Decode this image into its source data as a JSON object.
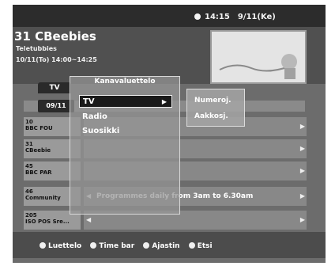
{
  "clock": {
    "time": "14:15",
    "date": "9/11(Ke)"
  },
  "info": {
    "channel_title": "31 CBeebies",
    "program_title": "Teletubbies",
    "program_time": "10/11(To) 14:00~14:25"
  },
  "guide": {
    "tab_label": "TV",
    "date_chip": "09/11",
    "rows": [
      {
        "channel": "10\nBBC FOU",
        "program": ""
      },
      {
        "channel": "31\nCBeebie",
        "program": ""
      },
      {
        "channel": "45\nBBC PAR",
        "program": ""
      },
      {
        "channel": "46\nCommunity",
        "program": "Programmes daily from 3am to 6.30am"
      },
      {
        "channel": "205\nISO POS Sre...",
        "program": ""
      }
    ]
  },
  "menu": {
    "title": "Kanavaluettelo",
    "items": [
      "TV",
      "Radio",
      "Suosikki"
    ],
    "submenu": [
      "Numeroj.",
      "Aakkosj."
    ]
  },
  "legend": [
    "Luettelo",
    "Time bar",
    "Ajastin",
    "Etsi"
  ]
}
